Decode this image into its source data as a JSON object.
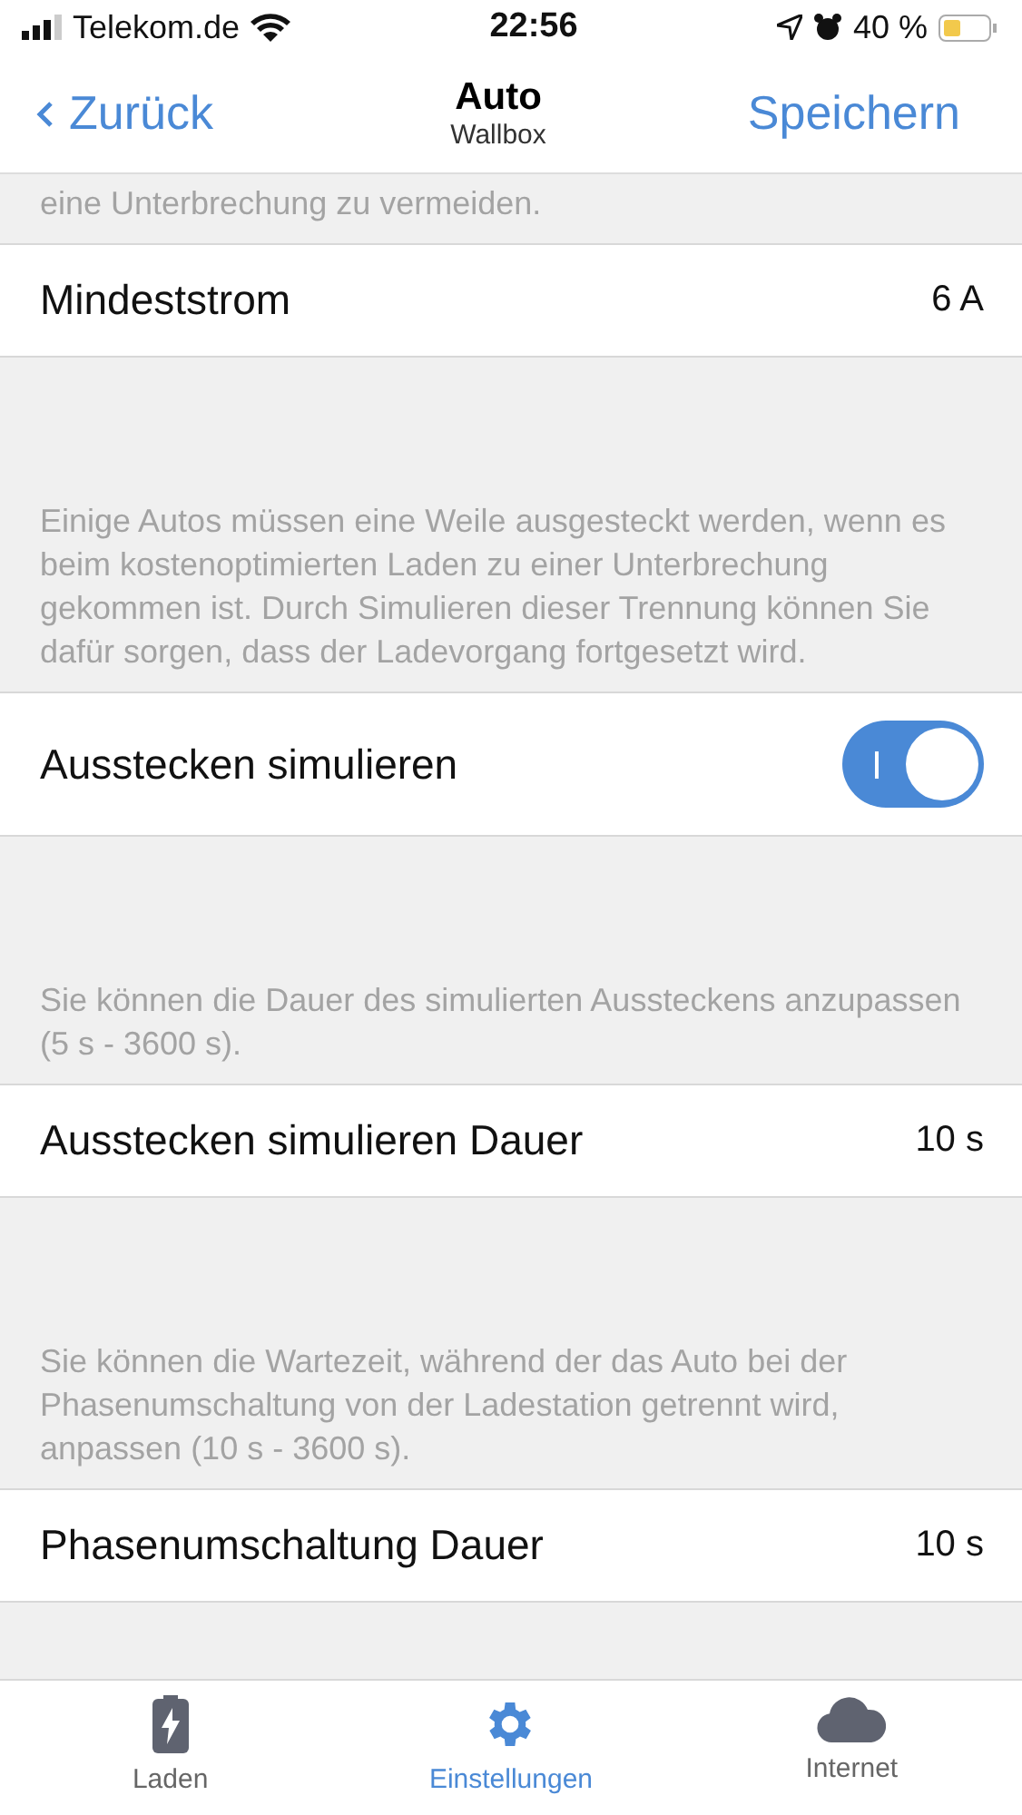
{
  "status_bar": {
    "carrier": "Telekom.de",
    "time": "22:56",
    "battery": "40 %"
  },
  "nav": {
    "back": "Zurück",
    "title": "Auto",
    "subtitle": "Wallbox",
    "action": "Speichern"
  },
  "sections": [
    {
      "description": "eine Unterbrechung zu vermeiden.",
      "row": {
        "kind": "value",
        "label": "Mindeststrom",
        "value": "6 A"
      }
    },
    {
      "description": "Einige Autos müssen eine Weile ausgesteckt werden, wenn es beim kostenoptimierten Laden zu einer Unterbrechung gekommen ist. Durch Simulieren dieser Trennung können Sie dafür sorgen, dass der Ladevorgang fortgesetzt wird.",
      "row": {
        "kind": "toggle",
        "label": "Ausstecken simulieren",
        "on": true
      }
    },
    {
      "description": "Sie können die Dauer des simulierten Aussteckens anzupassen (5 s - 3600 s).",
      "row": {
        "kind": "value",
        "label": "Ausstecken simulieren Dauer",
        "value": "10 s"
      }
    },
    {
      "description": "Sie können die Wartezeit, während der das Auto bei der Phasenumschaltung von der Ladestation getrennt wird, anpassen (10 s - 3600 s).",
      "row": {
        "kind": "value",
        "label": "Phasenumschaltung Dauer",
        "value": "10 s"
      }
    }
  ],
  "tabs": [
    {
      "kind": "battery",
      "label": "Laden",
      "selected": false
    },
    {
      "kind": "gear",
      "label": "Einstellungen",
      "selected": true
    },
    {
      "kind": "cloud",
      "label": "Internet",
      "selected": false
    }
  ]
}
